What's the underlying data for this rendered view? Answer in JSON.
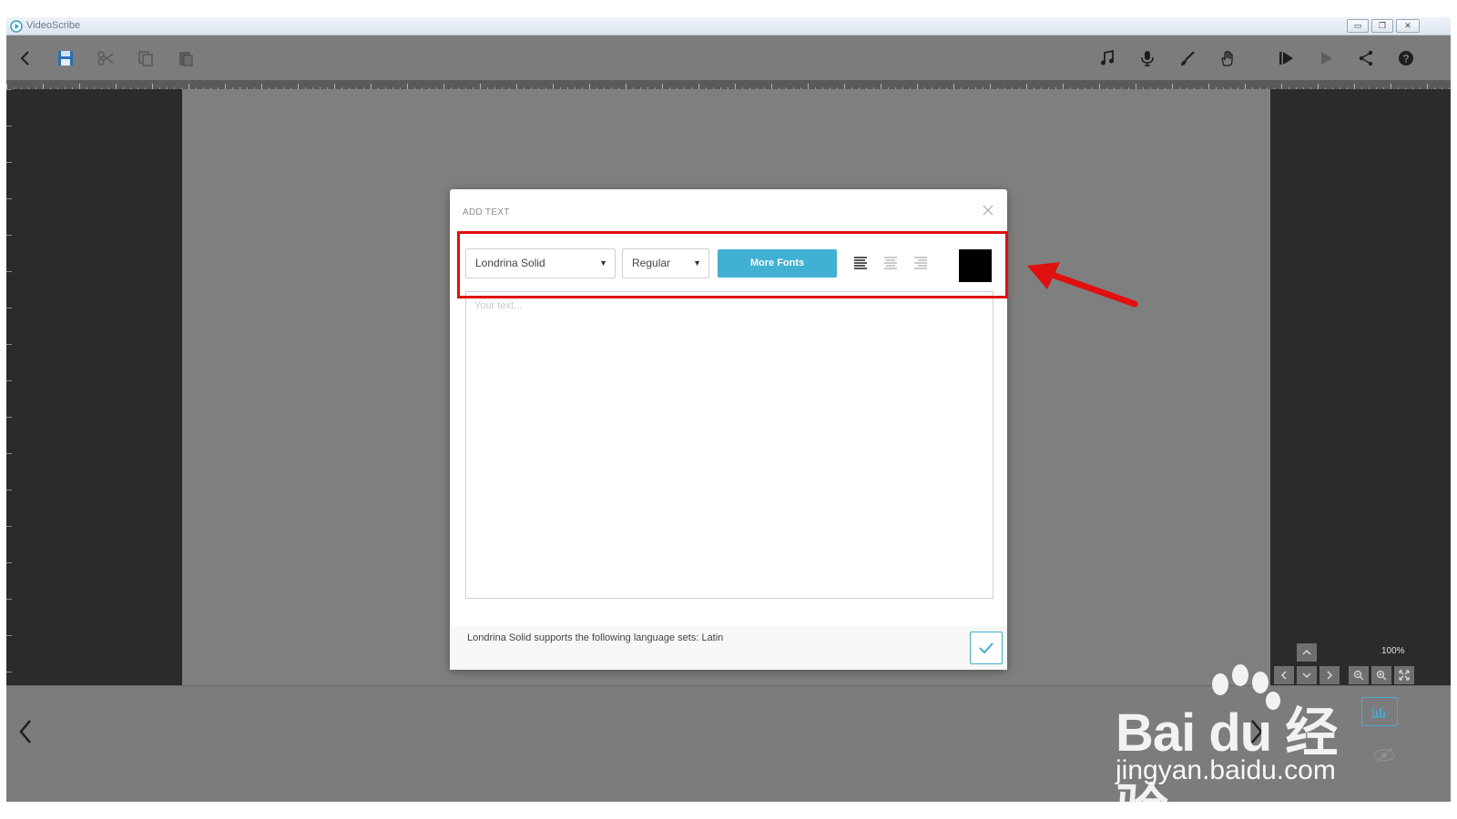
{
  "window": {
    "title": "VideoScribe",
    "controls": [
      "▭",
      "❐",
      "✕"
    ]
  },
  "toolbar": {
    "left_icons": [
      "back-icon",
      "save-icon",
      "cut-icon",
      "copy-icon",
      "paste-icon"
    ],
    "right_icons": [
      "music-icon",
      "microphone-icon",
      "brush-icon",
      "hand-icon",
      "preview-icon",
      "play-icon",
      "share-icon",
      "help-icon"
    ]
  },
  "dialog": {
    "title": "ADD TEXT",
    "font_select": {
      "value": "Londrina Solid"
    },
    "style_select": {
      "value": "Regular"
    },
    "more_fonts_label": "More Fonts",
    "alignments": [
      "align-left",
      "align-center",
      "align-right"
    ],
    "text_color": "#000000",
    "text_placeholder": "Your text...",
    "language_info": "Londrina Solid supports the following language sets: Latin"
  },
  "canvas_controls": {
    "zoom_label": "100%"
  },
  "colors": {
    "accent": "#40b0d3",
    "annotation": "#e01010"
  },
  "watermark": {
    "logo_text": "Bai du 经验",
    "url": "jingyan.baidu.com"
  }
}
